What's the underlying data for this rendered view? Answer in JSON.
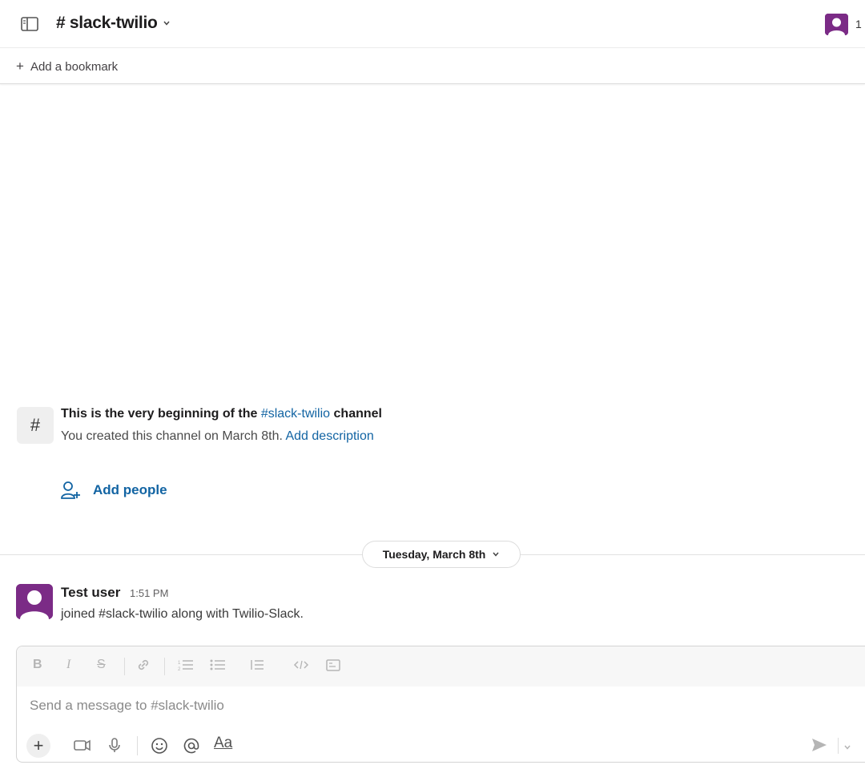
{
  "header": {
    "channel_name": "# slack-twilio",
    "member_count": "1"
  },
  "bookmarks": {
    "add_label": "Add a bookmark"
  },
  "intro": {
    "title_prefix": "This is the very beginning of the",
    "title_channel": "#slack-twilio",
    "title_suffix": "channel",
    "created_text": "You created this channel on March 8th.",
    "add_description": "Add description",
    "add_people": "Add people"
  },
  "date_divider": {
    "label": "Tuesday, March 8th"
  },
  "message": {
    "author": "Test user",
    "time": "1:51 PM",
    "body": "joined #slack-twilio along with Twilio-Slack."
  },
  "composer": {
    "placeholder": "Send a message to #slack-twilio",
    "format_buttons": [
      "B",
      "I",
      "S"
    ],
    "text_format_label": "Aa"
  },
  "colors": {
    "link": "#1264a3",
    "avatar": "#7b2b86"
  }
}
